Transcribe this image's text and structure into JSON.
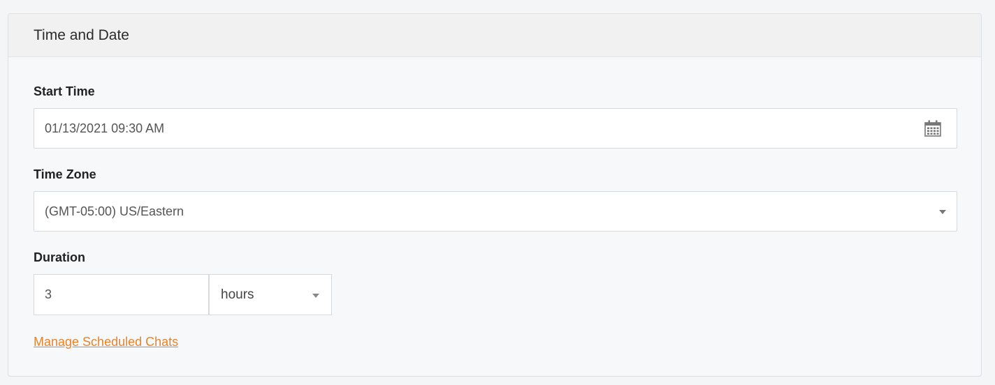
{
  "panel": {
    "title": "Time and Date"
  },
  "start_time": {
    "label": "Start Time",
    "value": "01/13/2021 09:30 AM",
    "icon": "calendar-icon"
  },
  "time_zone": {
    "label": "Time Zone",
    "selected": "(GMT-05:00) US/Eastern",
    "icon": "chevron-down-icon"
  },
  "duration": {
    "label": "Duration",
    "value": "3",
    "unit": "hours",
    "icon": "chevron-down-icon"
  },
  "links": {
    "manage_scheduled_chats": "Manage Scheduled Chats"
  },
  "colors": {
    "link": "#e8832a",
    "background": "#f7f8fa",
    "header": "#f1f1f1"
  }
}
